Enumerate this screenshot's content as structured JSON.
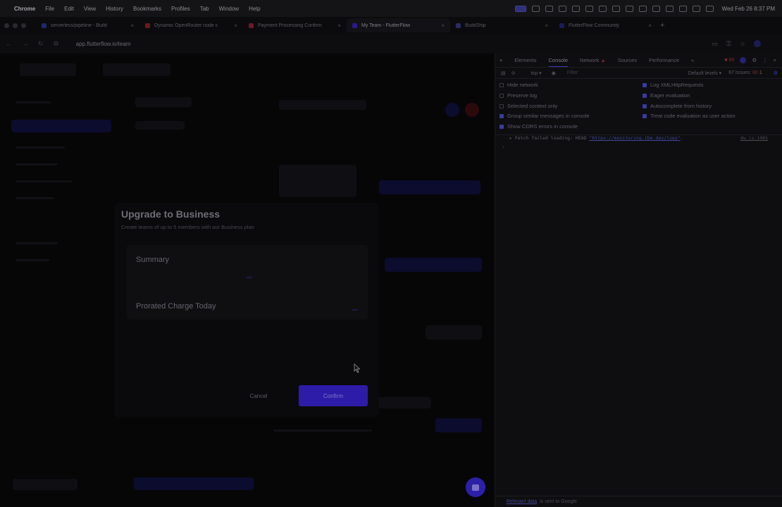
{
  "menubar": {
    "app": "Chrome",
    "items": [
      "File",
      "Edit",
      "View",
      "History",
      "Bookmarks",
      "Profiles",
      "Tab",
      "Window",
      "Help"
    ],
    "clock": "Wed Feb 26  8:37 PM"
  },
  "tabs": [
    {
      "title": "serverless/pipeline - Build",
      "favicon_color": "#1a2a6a"
    },
    {
      "title": "Dynamic OpenRouter node c",
      "favicon_color": "#6a1a1a"
    },
    {
      "title": "Payment Processing Confirm",
      "favicon_color": "#6a1a2a"
    },
    {
      "title": "My Team - FlutterFlow",
      "favicon_color": "#2a1a8a",
      "active": true
    },
    {
      "title": "BuildShip",
      "favicon_color": "#2a2a6a"
    },
    {
      "title": "FlutterFlow Community",
      "favicon_color": "#1a1a5a"
    }
  ],
  "address": {
    "url": "app.flutterflow.io/team"
  },
  "modal": {
    "title": "Upgrade to Business",
    "subtitle": "Create teams of up to 5 members with our Business plan",
    "summary_label": "Summary",
    "prorated_label": "Prorated Charge Today",
    "cancel_label": "Cancel",
    "confirm_label": "Confirm"
  },
  "devtools": {
    "tabs": [
      "Elements",
      "Console",
      "Network",
      "Sources",
      "Performance"
    ],
    "active_tab": "Console",
    "error_count": "80",
    "context": "top",
    "filter_placeholder": "Filter",
    "levels": "Default levels",
    "issues": "67 Issues:",
    "issues_err": "80",
    "issues_warn": "1",
    "options_left": [
      {
        "label": "Hide network",
        "checked": false
      },
      {
        "label": "Preserve log",
        "checked": false
      },
      {
        "label": "Selected context only",
        "checked": false
      },
      {
        "label": "Group similar messages in console",
        "checked": true
      },
      {
        "label": "Show CORS errors in console",
        "checked": true
      }
    ],
    "options_right": [
      {
        "label": "Log XMLHttpRequests",
        "checked": true
      },
      {
        "label": "Eager evaluation",
        "checked": true
      },
      {
        "label": "Autocomplete from history",
        "checked": true
      },
      {
        "label": "Treat code evaluation as user action",
        "checked": true
      }
    ],
    "log": {
      "prefix": "▸ Fetch failed loading: HEAD ",
      "url": "\"https://monitoring.ibm.dev/logs\"",
      "suffix": ".",
      "source": "dw.js:1085"
    },
    "footer_link": "Relevant data",
    "footer_text": "is sent to Google"
  }
}
